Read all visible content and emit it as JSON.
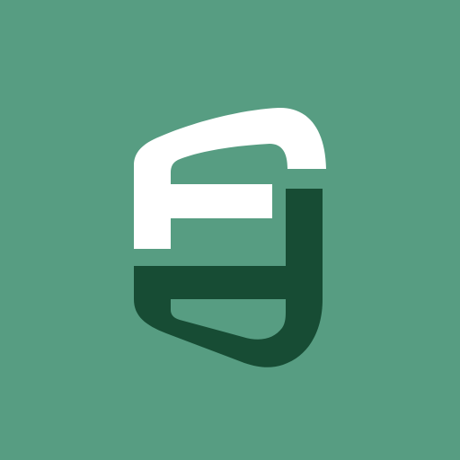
{
  "app_icon": {
    "icon": "fd-monogram-icon",
    "colors": {
      "background": "#579d82",
      "upper_glyph": "#ffffff",
      "lower_glyph": "#174c34"
    }
  }
}
